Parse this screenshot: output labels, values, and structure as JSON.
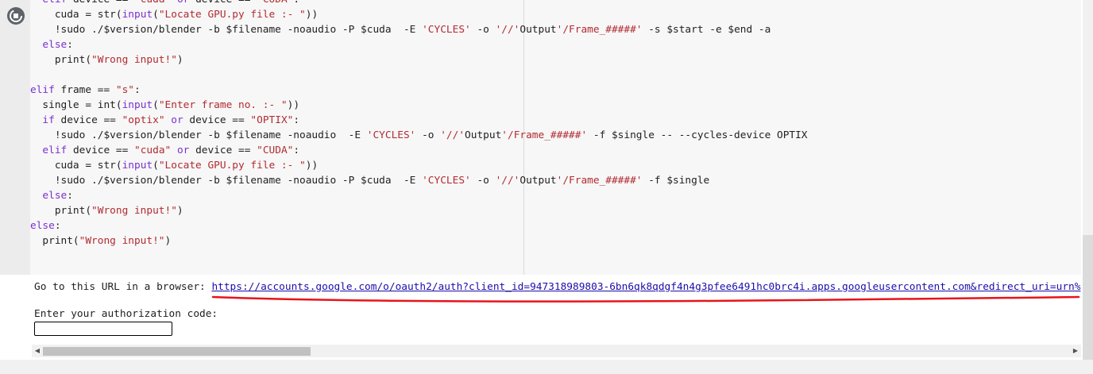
{
  "cell": {
    "run_button": {
      "icon": "stop-circle-icon"
    },
    "code_lines": [
      [
        {
          "t": "  "
        },
        {
          "t": "elif",
          "k": "kw"
        },
        {
          "t": " device == "
        },
        {
          "t": "\"cuda\"",
          "k": "str"
        },
        {
          "t": " "
        },
        {
          "t": "or",
          "k": "kw"
        },
        {
          "t": " device == "
        },
        {
          "t": "\"CUDA\"",
          "k": "str"
        },
        {
          "t": ":"
        }
      ],
      [
        {
          "t": "    cuda = str("
        },
        {
          "t": "input",
          "k": "kw"
        },
        {
          "t": "("
        },
        {
          "t": "\"Locate GPU.py file :- \"",
          "k": "str"
        },
        {
          "t": "))"
        }
      ],
      [
        {
          "t": "    !sudo ./$version/blender -b $filename -noaudio -P $cuda  -E "
        },
        {
          "t": "'CYCLES'",
          "k": "str"
        },
        {
          "t": " -o "
        },
        {
          "t": "'//'",
          "k": "str"
        },
        {
          "t": "Output"
        },
        {
          "t": "'/Frame_#####'",
          "k": "str"
        },
        {
          "t": " -s $start -e $end -a"
        }
      ],
      [
        {
          "t": "  "
        },
        {
          "t": "else",
          "k": "kw"
        },
        {
          "t": ":"
        }
      ],
      [
        {
          "t": "    print("
        },
        {
          "t": "\"Wrong input!\"",
          "k": "str"
        },
        {
          "t": ")"
        }
      ],
      [
        {
          "t": ""
        }
      ],
      [
        {
          "t": "elif",
          "k": "kw"
        },
        {
          "t": " frame == "
        },
        {
          "t": "\"s\"",
          "k": "str"
        },
        {
          "t": ":"
        }
      ],
      [
        {
          "t": "  single = int("
        },
        {
          "t": "input",
          "k": "kw"
        },
        {
          "t": "("
        },
        {
          "t": "\"Enter frame no. :- \"",
          "k": "str"
        },
        {
          "t": "))"
        }
      ],
      [
        {
          "t": "  "
        },
        {
          "t": "if",
          "k": "kw"
        },
        {
          "t": " device == "
        },
        {
          "t": "\"optix\"",
          "k": "str"
        },
        {
          "t": " "
        },
        {
          "t": "or",
          "k": "kw"
        },
        {
          "t": " device == "
        },
        {
          "t": "\"OPTIX\"",
          "k": "str"
        },
        {
          "t": ":"
        }
      ],
      [
        {
          "t": "    !sudo ./$version/blender -b $filename -noaudio  -E "
        },
        {
          "t": "'CYCLES'",
          "k": "str"
        },
        {
          "t": " -o "
        },
        {
          "t": "'//'",
          "k": "str"
        },
        {
          "t": "Output"
        },
        {
          "t": "'/Frame_#####'",
          "k": "str"
        },
        {
          "t": " -f $single -- --cycles-device OPTIX"
        }
      ],
      [
        {
          "t": "  "
        },
        {
          "t": "elif",
          "k": "kw"
        },
        {
          "t": " device == "
        },
        {
          "t": "\"cuda\"",
          "k": "str"
        },
        {
          "t": " "
        },
        {
          "t": "or",
          "k": "kw"
        },
        {
          "t": " device == "
        },
        {
          "t": "\"CUDA\"",
          "k": "str"
        },
        {
          "t": ":"
        }
      ],
      [
        {
          "t": "    cuda = str("
        },
        {
          "t": "input",
          "k": "kw"
        },
        {
          "t": "("
        },
        {
          "t": "\"Locate GPU.py file :- \"",
          "k": "str"
        },
        {
          "t": "))"
        }
      ],
      [
        {
          "t": "    !sudo ./$version/blender -b $filename -noaudio -P $cuda  -E "
        },
        {
          "t": "'CYCLES'",
          "k": "str"
        },
        {
          "t": " -o "
        },
        {
          "t": "'//'",
          "k": "str"
        },
        {
          "t": "Output"
        },
        {
          "t": "'/Frame_#####'",
          "k": "str"
        },
        {
          "t": " -f $single"
        }
      ],
      [
        {
          "t": "  "
        },
        {
          "t": "else",
          "k": "kw"
        },
        {
          "t": ":"
        }
      ],
      [
        {
          "t": "    print("
        },
        {
          "t": "\"Wrong input!\"",
          "k": "str"
        },
        {
          "t": ")"
        }
      ],
      [
        {
          "t": "else",
          "k": "kw"
        },
        {
          "t": ":"
        }
      ],
      [
        {
          "t": "  print("
        },
        {
          "t": "\"Wrong input!\"",
          "k": "str"
        },
        {
          "t": ")"
        }
      ]
    ]
  },
  "output": {
    "url_prompt": "Go to this URL in a browser: ",
    "url": "https://accounts.google.com/o/oauth2/auth?client_id=947318989803-6bn6qk8qdgf4n4g3pfee6491hc0brc4i.apps.googleusercontent.com&redirect_uri=urn%",
    "auth_prompt": "Enter your authorization code:",
    "auth_value": ""
  },
  "colors": {
    "keyword": "#7b30d0",
    "string": "#b22b31",
    "link": "#1a0dab",
    "annotation": "#e8141a"
  }
}
